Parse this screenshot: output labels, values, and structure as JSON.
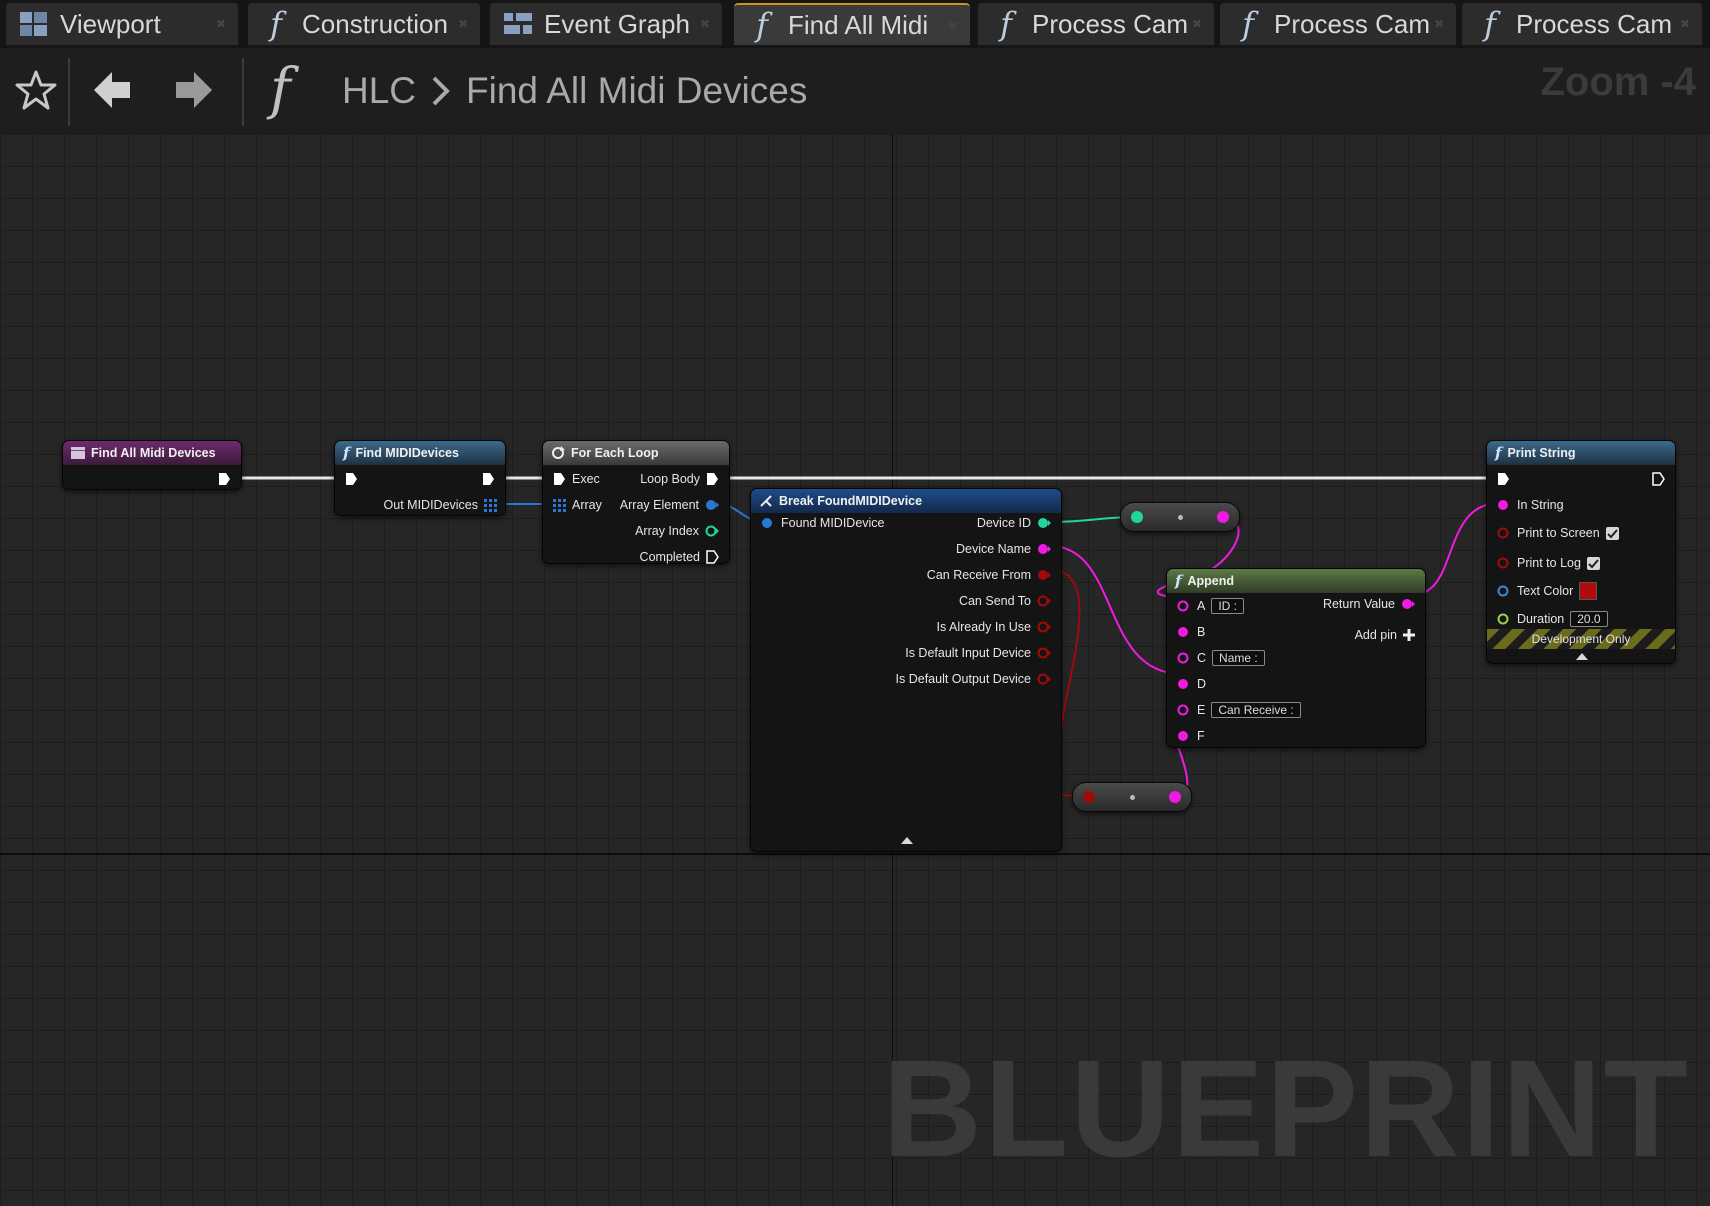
{
  "tabs": [
    {
      "label": "Viewport",
      "icon": "viewport-icon"
    },
    {
      "label": "Construction",
      "icon": "function-icon"
    },
    {
      "label": "Event Graph",
      "icon": "event-graph-icon"
    },
    {
      "label": "Find All Midi",
      "icon": "function-icon",
      "active": true
    },
    {
      "label": "Process Cam",
      "icon": "function-icon"
    },
    {
      "label": "Process Cam",
      "icon": "function-icon"
    },
    {
      "label": "Process Cam",
      "icon": "function-icon"
    }
  ],
  "toolbar": {
    "breadcrumb_parent": "HLC",
    "breadcrumb_current": "Find All Midi Devices",
    "zoom": "Zoom -4"
  },
  "graph": {
    "watermark": "BLUEPRINT",
    "colors": {
      "exec": "#ffffff",
      "array": "#2a78d6",
      "integer": "#20d6a0",
      "string": "#f01ae0",
      "boolean": "#a00a0a",
      "struct": "#2a78d6",
      "linear_color": "#3a8ad8",
      "float": "#9ad045"
    },
    "nodes": {
      "entry": {
        "title": "Find All Midi Devices"
      },
      "find": {
        "title": "Find MIDIDevices",
        "out": "Out MIDIDevices"
      },
      "loop": {
        "title": "For Each Loop",
        "exec": "Exec",
        "array": "Array",
        "loop_body": "Loop Body",
        "array_element": "Array Element",
        "array_index": "Array Index",
        "completed": "Completed"
      },
      "break": {
        "title": "Break FoundMIDIDevice",
        "input": "Found MIDIDevice",
        "outputs": [
          "Device ID",
          "Device Name",
          "Can Receive From",
          "Can Send To",
          "Is Already In Use",
          "Is Default Input Device",
          "Is Default Output Device"
        ]
      },
      "append": {
        "title": "Append",
        "pins": [
          "A",
          "B",
          "C",
          "D",
          "E",
          "F"
        ],
        "a_value": "ID :",
        "c_value": "Name :",
        "e_value": "Can Receive :",
        "return_value": "Return Value",
        "add_pin": "Add pin"
      },
      "print": {
        "title": "Print String",
        "in_string": "In String",
        "print_to_screen": "Print to Screen",
        "print_to_log": "Print to Log",
        "text_color": "Text Color",
        "duration": "Duration",
        "duration_value": "20.0",
        "dev_only": "Development Only"
      }
    }
  }
}
